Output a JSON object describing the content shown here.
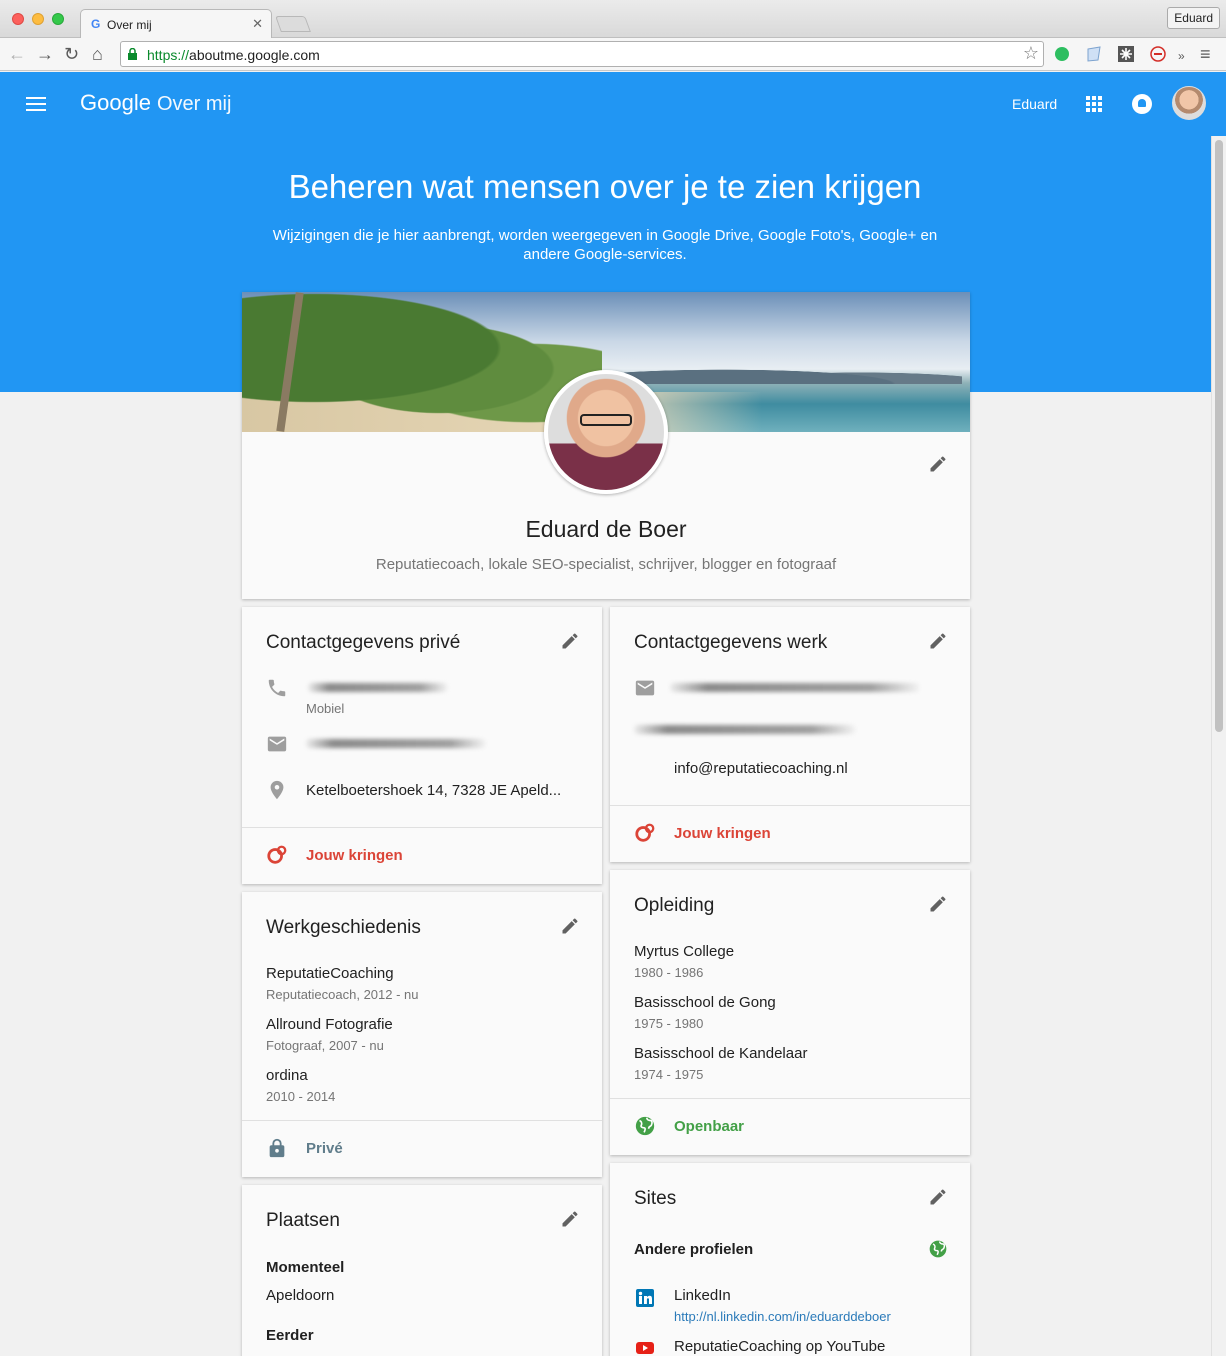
{
  "browser": {
    "tab_title": "Over mij",
    "profile_button": "Eduard",
    "url_scheme": "https://",
    "url_host": "aboutme.google.com"
  },
  "appbar": {
    "brand": "Google",
    "product": "Over mij",
    "user_name": "Eduard"
  },
  "hero": {
    "title": "Beheren wat mensen over je te zien krijgen",
    "subtitle": "Wijzigingen die je hier aanbrengt, worden weergegeven in Google Drive, Google Foto's, Google+ en andere Google-services."
  },
  "profile": {
    "name": "Eduard de Boer",
    "tagline": "Reputatiecoach, lokale SEO-specialist, schrijver, blogger en fotograaf"
  },
  "contact_private": {
    "title": "Contactgegevens privé",
    "phone_label": "Mobiel",
    "address": "Ketelboetershoek 14, 7328 JE Apeld...",
    "footer": "Jouw kringen"
  },
  "contact_work": {
    "title": "Contactgegevens werk",
    "email": "info@reputatiecoaching.nl",
    "footer": "Jouw kringen"
  },
  "work_history": {
    "title": "Werkgeschiedenis",
    "entries": [
      {
        "name": "ReputatieCoaching",
        "detail": "Reputatiecoach, 2012 - nu"
      },
      {
        "name": "Allround Fotografie",
        "detail": "Fotograaf, 2007 - nu"
      },
      {
        "name": "ordina",
        "detail": "2010 - 2014"
      }
    ],
    "footer": "Privé"
  },
  "education": {
    "title": "Opleiding",
    "entries": [
      {
        "name": "Myrtus College",
        "detail": "1980 - 1986"
      },
      {
        "name": "Basisschool de Gong",
        "detail": "1975 - 1980"
      },
      {
        "name": "Basisschool de Kandelaar",
        "detail": "1974 - 1975"
      }
    ],
    "footer": "Openbaar"
  },
  "places": {
    "title": "Plaatsen",
    "current_label": "Momenteel",
    "current_value": "Apeldoorn",
    "previous_label": "Eerder"
  },
  "sites": {
    "title": "Sites",
    "other_profiles_label": "Andere profielen",
    "links": [
      {
        "name": "LinkedIn",
        "url": "http://nl.linkedin.com/in/eduarddeboer"
      },
      {
        "name": "ReputatieCoaching op YouTube"
      }
    ]
  },
  "colors": {
    "brand_blue": "#2196f3",
    "circles_red": "#db4437",
    "public_green": "#43a047",
    "private_grey": "#607d8b"
  }
}
